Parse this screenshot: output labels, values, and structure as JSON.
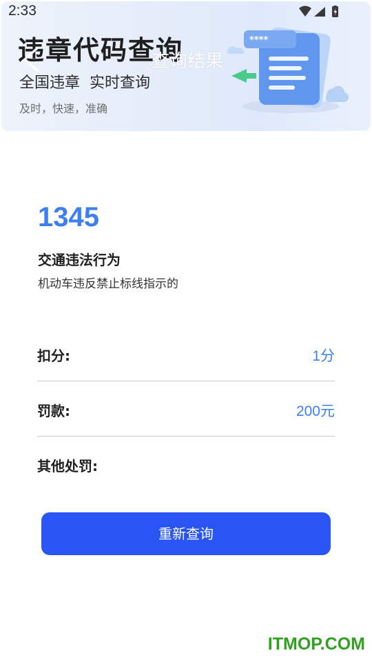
{
  "status_bar": {
    "time": "2:33",
    "icons": [
      "wifi-icon",
      "signal-icon",
      "battery-icon"
    ]
  },
  "banner": {
    "title": "违章代码查询",
    "subtitle": "全国违章  实时查询",
    "tagline": "及时，快速，准确",
    "illustration_text": "****"
  },
  "header": {
    "back_icon": "chevron-left-icon",
    "title": "查询结果"
  },
  "result": {
    "code": "1345",
    "behavior_label": "交通违法行为",
    "behavior_text": "机动车违反禁止标线指示的",
    "details": [
      {
        "label": "扣分:",
        "value": "1分"
      },
      {
        "label": "罚款:",
        "value": "200元"
      },
      {
        "label": "其他处罚:",
        "value": ""
      }
    ]
  },
  "actions": {
    "requery_label": "重新查询"
  },
  "watermark": {
    "text": "ITMOP.COM"
  },
  "colors": {
    "accent": "#3d7ff0",
    "button": "#2a55f5",
    "watermark": "#2fa11f"
  }
}
